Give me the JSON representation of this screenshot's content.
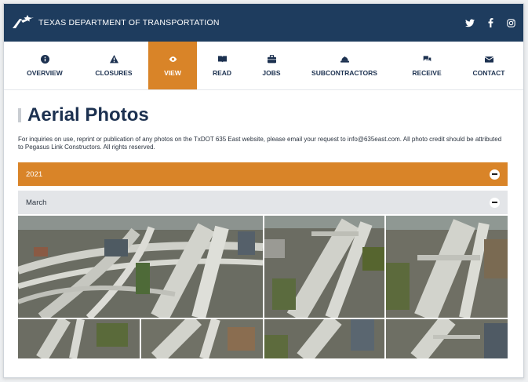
{
  "header": {
    "brand": "TEXAS DEPARTMENT OF TRANSPORTATION",
    "colors": {
      "bar": "#1e3c5e",
      "accent": "#d98428"
    },
    "social": [
      {
        "icon": "twitter-icon",
        "glyph": "𝕥"
      },
      {
        "icon": "facebook-icon",
        "glyph": "f"
      },
      {
        "icon": "instagram-icon",
        "glyph": "◎"
      }
    ]
  },
  "nav": {
    "items": [
      {
        "label": "OVERVIEW",
        "icon": "info-icon"
      },
      {
        "label": "CLOSURES",
        "icon": "warning-icon"
      },
      {
        "label": "VIEW",
        "icon": "eye-icon",
        "active": true
      },
      {
        "label": "READ",
        "icon": "book-icon"
      },
      {
        "label": "JOBS",
        "icon": "briefcase-icon"
      },
      {
        "label": "SUBCONTRACTORS",
        "icon": "hardhat-icon"
      },
      {
        "label": "RECEIVE",
        "icon": "chat-icon"
      },
      {
        "label": "CONTACT",
        "icon": "envelope-icon"
      }
    ]
  },
  "main": {
    "title": "Aerial Photos",
    "intro": "For inquiries on use, reprint or publication of any photos on the TxDOT 635 East website, please email your request to info@635east.com. All photo credit should be attributed to Pegasus Link Constructors. All rights reserved.",
    "accordion": {
      "year": "2021",
      "month": "March"
    }
  }
}
